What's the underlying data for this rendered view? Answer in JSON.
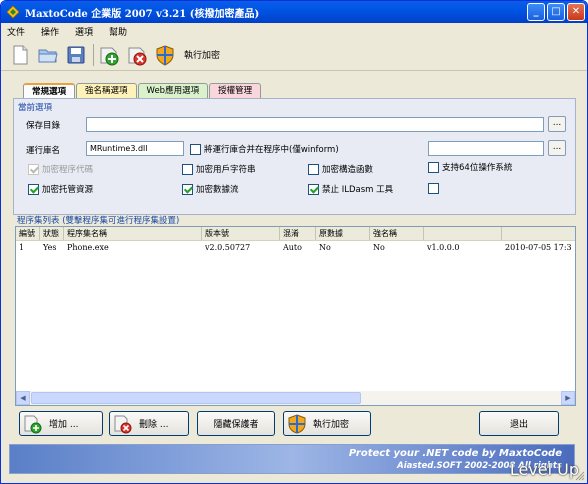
{
  "window": {
    "title": "MaxtoCode 企業版 2007 v3.21 (核撥加密產品)",
    "controls": {
      "minimize": "_",
      "maximize": "□",
      "close": "✕"
    }
  },
  "menu": [
    "文件",
    "操作",
    "選項",
    "幫助"
  ],
  "toolbar": {
    "run_encrypt_label": "執行加密"
  },
  "tabs": [
    "常規選項",
    "強名稱選項",
    "Web應用選項",
    "授權管理"
  ],
  "current_options": {
    "section_title": "當前選項",
    "save_dir_label": "保存目錄",
    "save_dir_value": "",
    "runtime_label": "運行庫名",
    "runtime_value": "MRuntime3.dll",
    "merge_label": "將運行庫合并在程序中(僅winform)",
    "merge_path_value": "",
    "browse_label": "...",
    "checkboxes": [
      {
        "label": "加密程序代碼",
        "checked": true,
        "disabled": true
      },
      {
        "label": "加密用戶字符串",
        "checked": false,
        "disabled": false
      },
      {
        "label": "加密構造函數",
        "checked": false,
        "disabled": false
      },
      {
        "label": "支持64位操作系統",
        "checked": false,
        "disabled": false
      },
      {
        "label": "加密托管資源",
        "checked": true,
        "disabled": false
      },
      {
        "label": "加密數據流",
        "checked": true,
        "disabled": false
      },
      {
        "label": "禁止 ILDasm 工具",
        "checked": true,
        "disabled": false
      },
      {
        "label": "",
        "checked": false,
        "disabled": false
      }
    ]
  },
  "assembly_list": {
    "title": "程序集列表 (雙擊程序集可進行程序集設置)",
    "columns": [
      "編號",
      "狀態",
      "程序集名稱",
      "版本號",
      "混淆",
      "原數據",
      "強名稱",
      "",
      ""
    ],
    "rows": [
      [
        "1",
        "Yes",
        "Phone.exe",
        "v2.0.50727",
        "Auto",
        "No",
        "No",
        "v1.0.0.0",
        "2010-07-05 17:3"
      ]
    ]
  },
  "buttons": {
    "add": "增加 ...",
    "delete": "刪除 ...",
    "hide_protector": "隱藏保護者",
    "run_encrypt": "執行加密",
    "exit": "退出"
  },
  "footer": {
    "line1": "Protect your .NET code by MaxtoCode",
    "line2": "Aiasted.SOFT 2002-2008 All rights"
  },
  "watermark": "Level Up"
}
